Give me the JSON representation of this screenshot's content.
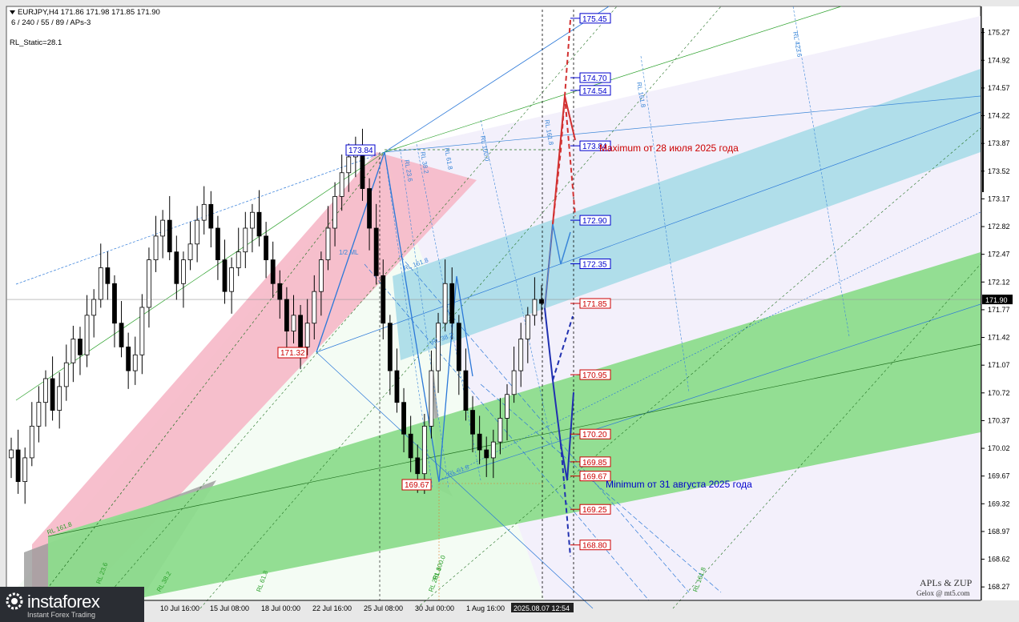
{
  "header": {
    "symbol_line": "EURJPY,H4  171.86 171.98 171.85 171.90",
    "params_line": "6 / 240 / 55 / 89 / APs-3",
    "static_line": "RL_Static=28.1"
  },
  "brand": {
    "name": "instaforex",
    "tagline": "Instant Forex Trading",
    "watermark_title": "APLs & ZUP",
    "watermark_sub": "Gelox @ mt5.com"
  },
  "annotations": {
    "maximum": "Maximum от 28 июля 2025 года",
    "minimum": "Minimum от 31 августа 2025 года"
  },
  "chart_labels_small": [
    "1/2 ML",
    "RL 161.8",
    "RL 100.0",
    "RL 61.8",
    "RL 38.2",
    "RL 23.6",
    "RL 161.8",
    "RL 161.8",
    "RL 423.6",
    "RL 161.8",
    "RL 261.8",
    "RL 100.0",
    "RL 38.2",
    "RL 61.8",
    "RL 23.6",
    "RL 161.8",
    "RL 38.2",
    "RL 61.8"
  ],
  "chart_data": {
    "type": "candlestick",
    "ylim": [
      168.1,
      175.6
    ],
    "y_ticks": [
      "175.27",
      "174.92",
      "174.57",
      "174.22",
      "173.87",
      "173.52",
      "173.17",
      "172.82",
      "172.47",
      "172.12",
      "171.77",
      "171.42",
      "171.07",
      "170.72",
      "170.37",
      "170.02",
      "169.67",
      "169.32",
      "168.97",
      "168.62",
      "168.27"
    ],
    "x_ticks": [
      "10 Jul 16:00",
      "15 Jul 08:00",
      "18 Jul 00:00",
      "22 Jul 16:00",
      "25 Jul 08:00",
      "30 Jul 00:00",
      "1 Aug 16:00"
    ],
    "current_price": "171.90",
    "current_time": "2025.08.07 12:54",
    "price_levels": [
      {
        "value": 175.45,
        "label": "175.45",
        "color": "#0000cc"
      },
      {
        "value": 174.7,
        "label": "174.70",
        "color": "#0000cc"
      },
      {
        "value": 174.54,
        "label": "174.54",
        "color": "#0000cc"
      },
      {
        "value": 173.84,
        "label": "173.84",
        "color": "#0000cc"
      },
      {
        "value": 172.9,
        "label": "172.90",
        "color": "#0000cc"
      },
      {
        "value": 172.35,
        "label": "172.35",
        "color": "#0000cc"
      },
      {
        "value": 171.85,
        "label": "171.85",
        "color": "#cc0000"
      },
      {
        "value": 170.95,
        "label": "170.95",
        "color": "#cc0000"
      },
      {
        "value": 170.2,
        "label": "170.20",
        "color": "#cc0000"
      },
      {
        "value": 169.85,
        "label": "169.85",
        "color": "#cc0000"
      },
      {
        "value": 169.67,
        "label": "169.67",
        "color": "#cc0000"
      },
      {
        "value": 169.25,
        "label": "169.25",
        "color": "#cc0000"
      },
      {
        "value": 168.8,
        "label": "168.80",
        "color": "#cc0000"
      }
    ],
    "pivots": [
      {
        "label": "173.84",
        "value": 173.84,
        "color": "#0000cc"
      },
      {
        "label": "171.32",
        "value": 171.32,
        "color": "#cc0000"
      },
      {
        "label": "169.67",
        "value": 169.67,
        "color": "#cc0000"
      }
    ],
    "close_path": [
      170.0,
      169.6,
      169.9,
      170.3,
      170.6,
      170.9,
      170.5,
      170.8,
      171.1,
      171.4,
      171.2,
      171.7,
      171.9,
      172.3,
      172.1,
      171.6,
      171.3,
      171.0,
      171.2,
      171.8,
      172.4,
      172.7,
      172.9,
      172.5,
      172.1,
      172.4,
      172.6,
      172.9,
      173.1,
      172.8,
      172.4,
      172.0,
      172.3,
      172.5,
      172.8,
      173.0,
      172.7,
      172.4,
      172.1,
      171.9,
      171.5,
      171.7,
      171.3,
      171.6,
      172.0,
      172.4,
      172.8,
      173.2,
      173.5,
      173.7,
      173.8,
      173.3,
      172.8,
      172.2,
      171.6,
      171.0,
      170.6,
      170.2,
      169.9,
      169.7,
      170.3,
      171.0,
      171.6,
      172.1,
      171.6,
      171.0,
      170.5,
      170.2,
      170.0,
      169.9,
      170.1,
      170.4,
      170.7,
      171.0,
      171.4,
      171.7,
      171.9,
      171.85
    ]
  }
}
